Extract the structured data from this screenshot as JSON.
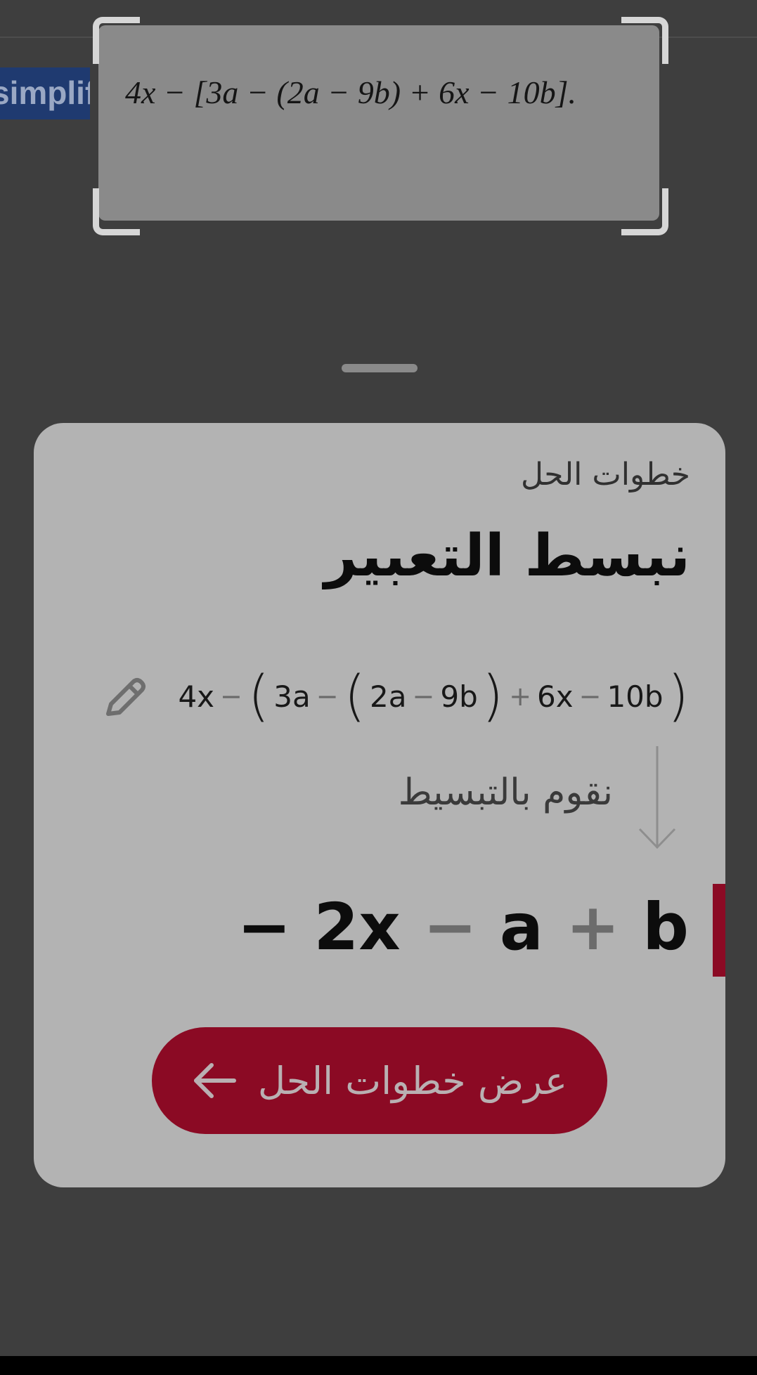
{
  "camera": {
    "highlighted_word": "simplify",
    "highlight_tail": "y",
    "expression": "4x − [3a − (2a − 9b) + 6x − 10b]."
  },
  "card": {
    "caption": "خطوات الحل",
    "title": "نبسط التعبير",
    "equation": {
      "t1": "4x",
      "op1": "−",
      "t2": "3a",
      "op2": "−",
      "t3": "2a",
      "op3": "−",
      "t4": "9b",
      "op4": "+",
      "t5": "6x",
      "op5": "−",
      "t6": "10b"
    },
    "step_label": "نقوم بالتبسيط",
    "result": {
      "lead": "− 2x",
      "op1": "−",
      "mid": "a",
      "op2": "+",
      "last": "b"
    },
    "button_label": "عرض خطوات الحل"
  },
  "colors": {
    "accent": "#8b0a24",
    "card_background": "#b3b3b3",
    "overlay": "#3d3d3d"
  },
  "icons": {
    "edit": "pencil-icon",
    "step": "arrow-down-icon",
    "button": "arrow-left-icon"
  }
}
